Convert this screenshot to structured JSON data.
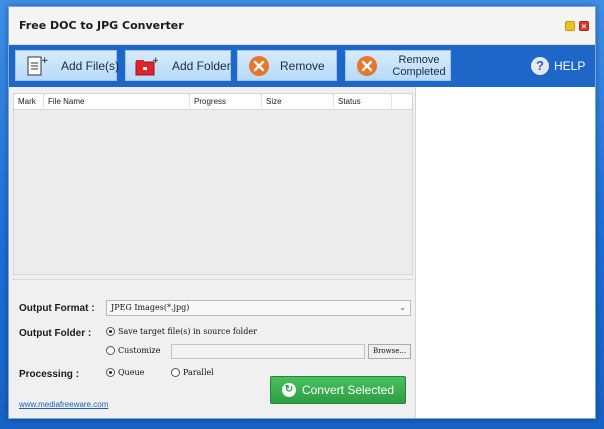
{
  "app": {
    "title": "Free DOC to JPG Converter"
  },
  "toolbar": {
    "add_files": "Add File(s)",
    "add_folder": "Add Folder",
    "remove": "Remove",
    "remove_completed_line1": "Remove",
    "remove_completed_line2": "Completed",
    "help": "HELP"
  },
  "list": {
    "columns": [
      "Mark",
      "File Name",
      "Progress",
      "Size",
      "Status"
    ],
    "rows": []
  },
  "options": {
    "output_format_label": "Output Format :",
    "output_format_value": "JPEG Images(*.jpg)",
    "output_folder_label": "Output Folder :",
    "save_in_source": "Save target file(s) in source folder",
    "customize": "Customize",
    "browse": "Browse...",
    "processing_label": "Processing :",
    "queue": "Queue",
    "parallel": "Parallel"
  },
  "convert_label": "Convert Selected",
  "footer": {
    "website": "www.mediafreeware.com"
  },
  "colors": {
    "toolbar": "#1e67c9",
    "convert": "#2e9e42",
    "button_bg": "#c6e2fb"
  }
}
